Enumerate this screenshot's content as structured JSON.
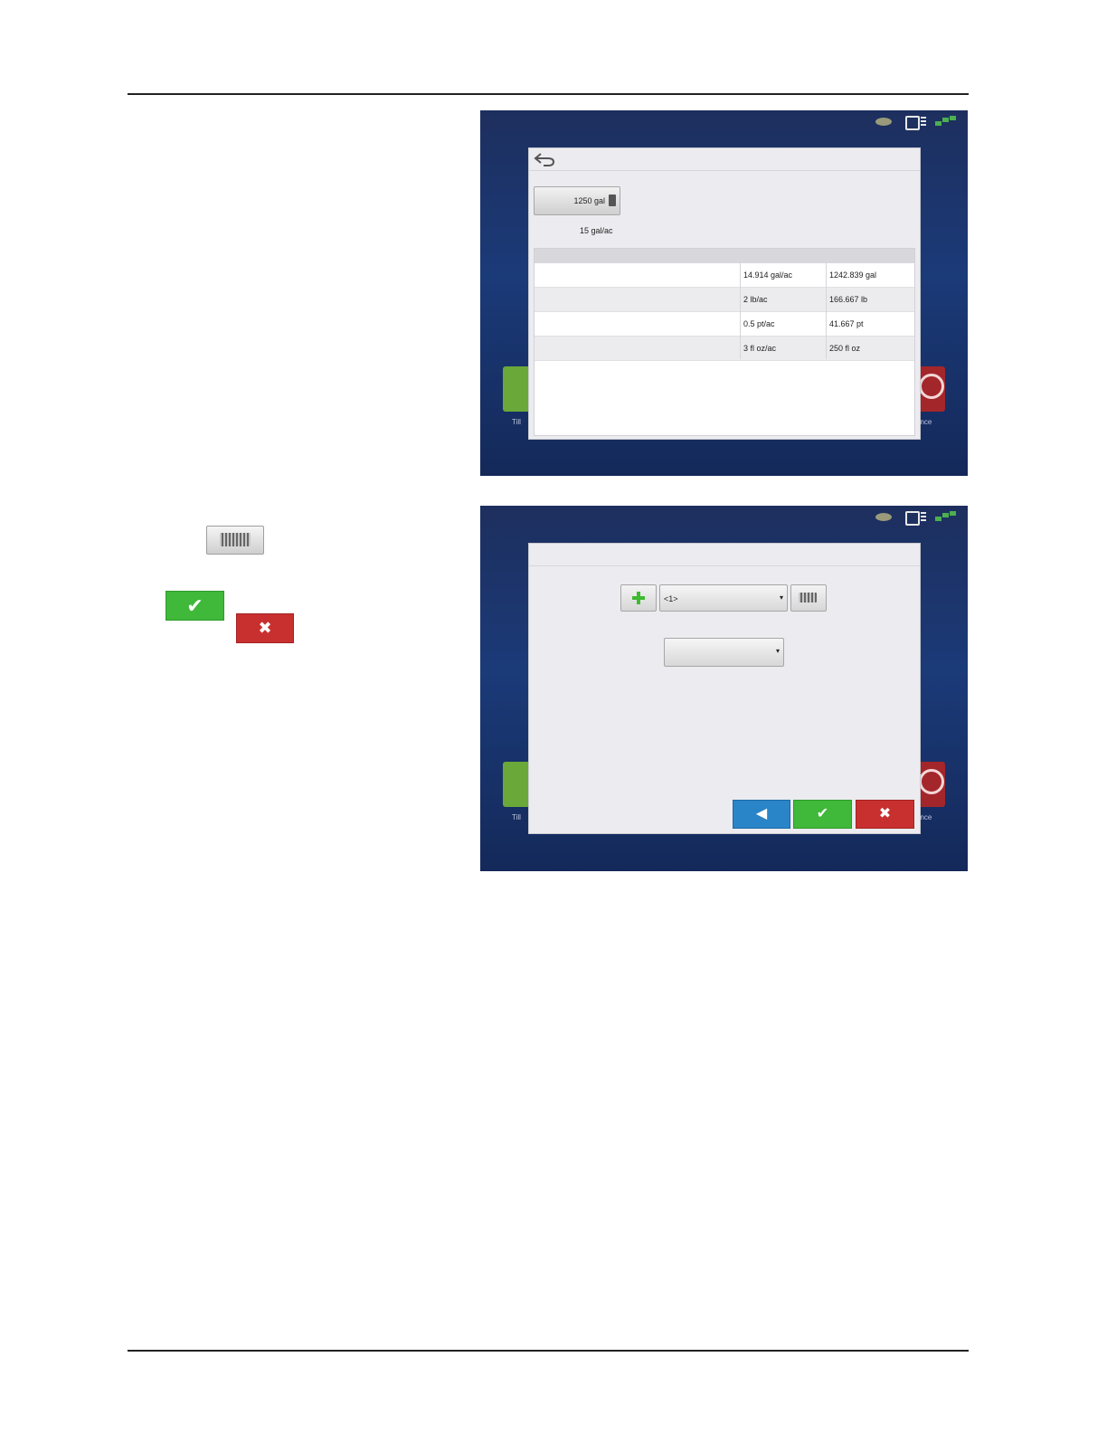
{
  "screen1": {
    "total_button": "1250 gal",
    "rate_text": "15 gal/ac",
    "rows": [
      {
        "rate": "14.914 gal/ac",
        "total": "1242.839 gal"
      },
      {
        "rate": "2 lb/ac",
        "total": "166.667 lb"
      },
      {
        "rate": "0.5 pt/ac",
        "total": "41.667 pt"
      },
      {
        "rate": "3 fl oz/ac",
        "total": "250 fl oz"
      }
    ],
    "home_left_label": "Till",
    "home_right_label": "ance"
  },
  "screen2": {
    "name_select": "<1>",
    "type_select": "",
    "home_left_label": "Till",
    "home_right_label": "ance"
  },
  "icons": {
    "check": "✔",
    "cross": "✖",
    "prev": "◀",
    "dropdown": "▾"
  },
  "colors": {
    "ok_green": "#40b83a",
    "cancel_red": "#c8302f",
    "prev_blue": "#2a84c8",
    "screen_blue": "#1b3a78"
  }
}
